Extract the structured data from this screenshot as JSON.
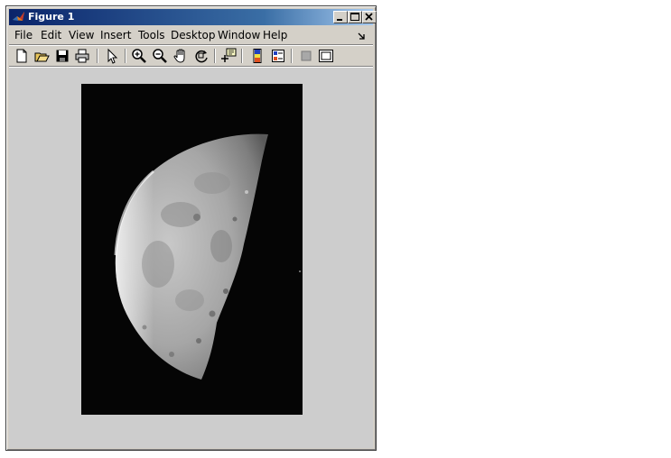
{
  "window": {
    "title": "Figure 1",
    "title_icon": "matlab-logo-icon",
    "controls": [
      "minimize-icon",
      "maximize-icon",
      "close-icon"
    ]
  },
  "menubar": {
    "items": [
      "File",
      "Edit",
      "View",
      "Insert",
      "Tools",
      "Desktop",
      "Window",
      "Help"
    ],
    "dock_arrow_icon": "dock-arrow-icon"
  },
  "toolbar": {
    "tools": [
      "new-figure-icon",
      "open-file-icon",
      "save-figure-icon",
      "print-figure-icon",
      "edit-plot-icon",
      "zoom-in-icon",
      "zoom-out-icon",
      "pan-icon",
      "rotate-3d-icon",
      "data-cursor-icon",
      "insert-colorbar-icon",
      "insert-legend-icon",
      "hide-plot-tools-icon",
      "show-plot-tools-icon"
    ]
  },
  "figure": {
    "content": "moon-image",
    "background_color": "#cdcdcd",
    "image_background": "#050505"
  }
}
